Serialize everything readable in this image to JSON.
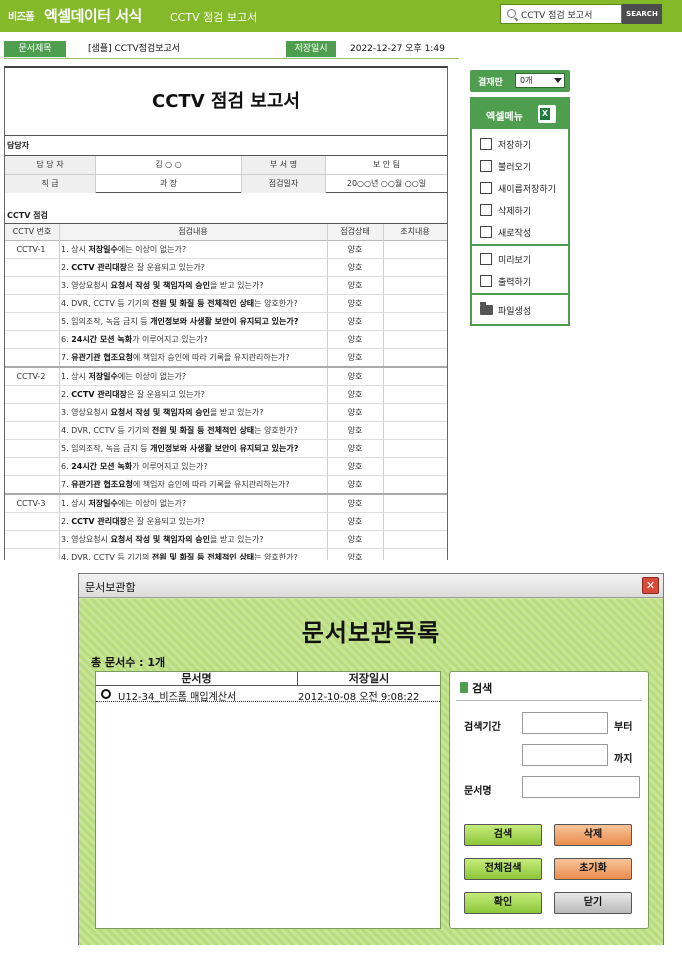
{
  "header": {
    "brand_logo": "비즈폼",
    "brand_title": "엑셀데이터 서식",
    "brand_sub": "CCTV 점검 보고서",
    "search_value": "CCTV 점검 보고서",
    "search_button": "SEARCH",
    "bg_color": "#84b92a"
  },
  "info_bar": {
    "title_label": "문서제목",
    "title_value": "[샘플] CCTV점검보고서",
    "saved_label": "저장일시",
    "saved_value": "2022-12-27  오후 1:49"
  },
  "document": {
    "title": "CCTV 점검 보고서",
    "manager_section": "담당자",
    "manager_table": {
      "r1": [
        "담 당 자",
        "김 ○ ○",
        "부 서 명",
        "보 안 팀"
      ],
      "r2": [
        "직 급",
        "과 장",
        "점검일자",
        "20○○년 ○○월 ○○일"
      ]
    },
    "check_section": "CCTV 점검",
    "columns": [
      "CCTV 번호",
      "점검내용",
      "점검상태",
      "조치내용"
    ],
    "groups": [
      {
        "id": "CCTV-1",
        "items": [
          {
            "pre": "1. 상시 ",
            "bold": "저장일수",
            "post": "에는 이상이 없는가?",
            "status": "양호"
          },
          {
            "pre": "2. ",
            "bold": "CCTV 관리대장",
            "post": "은 잘 운용되고 있는가?",
            "status": "양호"
          },
          {
            "pre": "3. 영상요청시 ",
            "bold": "요청서 작성 및 책임자의 승인",
            "post": "을 받고 있는가?",
            "status": "양호"
          },
          {
            "pre": "4. DVR, CCTV 등 기기의 ",
            "bold": "전원 및 화질 등 전체적인 상태",
            "post": "는 양호한가?",
            "status": "양호"
          },
          {
            "pre": "5. 임의조작, 녹음 금지 등 ",
            "bold": "개인정보와 사생활 보안이 유지되고 있는가?",
            "post": "",
            "status": "양호"
          },
          {
            "pre": "6. ",
            "bold": "24시간 모션 녹화",
            "post": "가 이루어지고 있는가?",
            "status": "양호"
          },
          {
            "pre": "7. ",
            "bold": "유관기관 협조요청",
            "post": "에 책임자 승인에 따라 기록을 유지관리하는가?",
            "status": "양호"
          }
        ]
      },
      {
        "id": "CCTV-2",
        "items": [
          {
            "pre": "1. 상시 ",
            "bold": "저장일수",
            "post": "에는 이상이 없는가?",
            "status": "양호"
          },
          {
            "pre": "2. ",
            "bold": "CCTV 관리대장",
            "post": "은 잘 운용되고 있는가?",
            "status": "양호"
          },
          {
            "pre": "3. 영상요청시 ",
            "bold": "요청서 작성 및 책임자의 승인",
            "post": "을 받고 있는가?",
            "status": "양호"
          },
          {
            "pre": "4. DVR, CCTV 등 기기의 ",
            "bold": "전원 및 화질 등 전체적인 상태",
            "post": "는 양호한가?",
            "status": "양호"
          },
          {
            "pre": "5. 임의조작, 녹음 금지 등 ",
            "bold": "개인정보와 사생활 보안이 유지되고 있는가?",
            "post": "",
            "status": "양호"
          },
          {
            "pre": "6. ",
            "bold": "24시간 모션 녹화",
            "post": "가 이루어지고 있는가?",
            "status": "양호"
          },
          {
            "pre": "7. ",
            "bold": "유관기관 협조요청",
            "post": "에 책임자 승인에 따라 기록을 유지관리하는가?",
            "status": "양호"
          }
        ]
      },
      {
        "id": "CCTV-3",
        "items": [
          {
            "pre": "1. 상시 ",
            "bold": "저장일수",
            "post": "에는 이상이 없는가?",
            "status": "양호"
          },
          {
            "pre": "2. ",
            "bold": "CCTV 관리대장",
            "post": "은 잘 운용되고 있는가?",
            "status": "양호"
          },
          {
            "pre": "3. 영상요청시 ",
            "bold": "요청서 작성 및 책임자의 승인",
            "post": "을 받고 있는가?",
            "status": "양호"
          },
          {
            "pre": "4. DVR, CCTV 등 기기의 ",
            "bold": "전원 및 화질 등 전체적인 상태",
            "post": "는 양호한가?",
            "status": "양호"
          }
        ]
      }
    ]
  },
  "sidebar": {
    "approval_label": "결재란",
    "approval_value": "0개",
    "menu_title": "엑셀메뉴",
    "items": [
      {
        "label": "저장하기",
        "icon": "save-icon"
      },
      {
        "label": "불러오기",
        "icon": "load-icon"
      },
      {
        "label": "새이름저장하기",
        "icon": "save-as-icon"
      },
      {
        "label": "삭제하기",
        "icon": "trash-icon"
      },
      {
        "label": "새로작성",
        "icon": "new-document-icon"
      },
      {
        "label": "미리보기",
        "icon": "preview-icon"
      },
      {
        "label": "출력하기",
        "icon": "print-icon"
      },
      {
        "label": "파일생성",
        "icon": "folder-icon"
      }
    ],
    "accent_color": "#4f9e4f"
  },
  "dialog": {
    "title": "문서보관함",
    "heading": "문서보관목록",
    "count_text": "총 문서수 : 1개",
    "columns": [
      "문서명",
      "저장일시"
    ],
    "rows": [
      {
        "name": "U12-34_비즈폼 매입계산서",
        "date": "2012-10-08 오전 9:08:22"
      }
    ],
    "search_title": "검색",
    "period_label": "검색기간",
    "from_suffix": "부터",
    "to_suffix": "까지",
    "docname_label": "문서명",
    "buttons": {
      "search": "검색",
      "delete": "삭제",
      "search_all": "전체검색",
      "reset": "초기화",
      "ok": "확인",
      "close": "닫기"
    }
  }
}
